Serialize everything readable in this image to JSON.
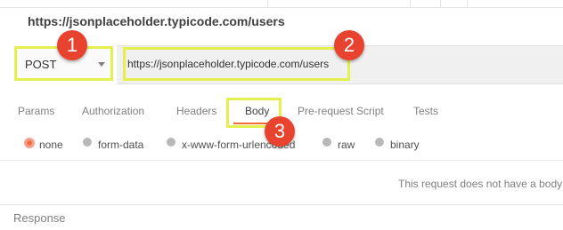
{
  "request": {
    "title": "https://jsonplaceholder.typicode.com/users",
    "method": "POST",
    "url": "https://jsonplaceholder.typicode.com/users"
  },
  "annotations": [
    "1",
    "2",
    "3"
  ],
  "tabs": [
    {
      "label": "Params"
    },
    {
      "label": "Authorization"
    },
    {
      "label": "Headers"
    },
    {
      "label": "Body"
    },
    {
      "label": "Pre-request Script"
    },
    {
      "label": "Tests"
    }
  ],
  "active_tab": "Body",
  "body_types": [
    {
      "label": "none",
      "selected": true
    },
    {
      "label": "form-data",
      "selected": false
    },
    {
      "label": "x-www-form-urlencoded",
      "selected": false
    },
    {
      "label": "raw",
      "selected": false
    },
    {
      "label": "binary",
      "selected": false
    }
  ],
  "empty_message": "This request does not have a body",
  "response_label": "Response",
  "colors": {
    "highlight": "#e3f04e",
    "badge": "#e8432f",
    "accent": "#f26b3a"
  }
}
